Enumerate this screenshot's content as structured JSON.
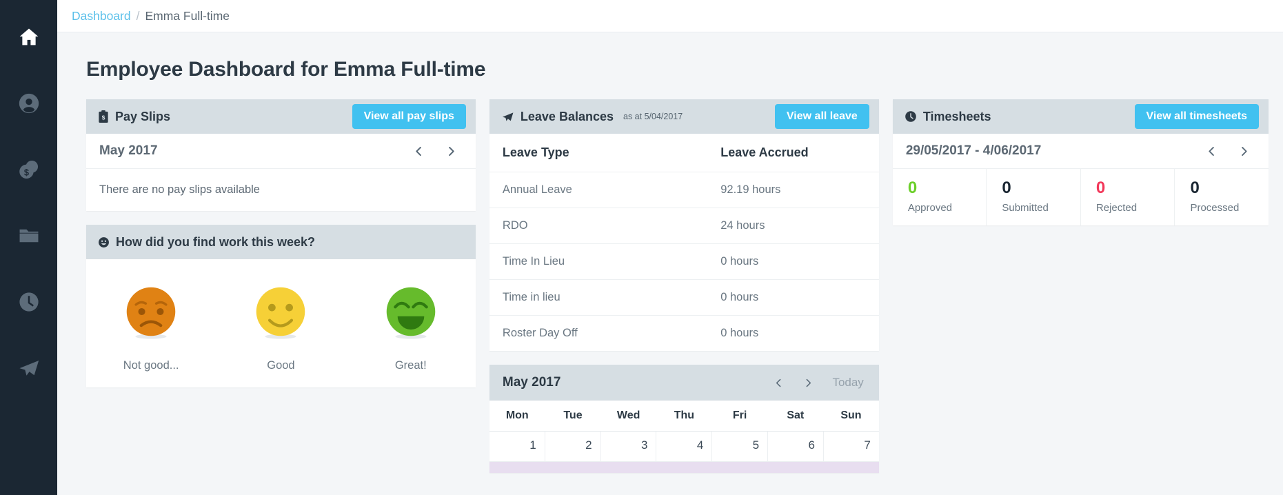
{
  "sidebar": {
    "items": [
      {
        "name": "home-icon",
        "label": "Home",
        "active": true
      },
      {
        "name": "user-icon",
        "label": "People"
      },
      {
        "name": "money-icon",
        "label": "Pay"
      },
      {
        "name": "folder-icon",
        "label": "Documents"
      },
      {
        "name": "clock-icon",
        "label": "Time"
      },
      {
        "name": "plane-icon",
        "label": "Leave"
      }
    ]
  },
  "breadcrumb": {
    "root": "Dashboard",
    "separator": "/",
    "current": "Emma Full-time"
  },
  "page": {
    "title": "Employee Dashboard for Emma Full-time"
  },
  "payslips": {
    "icon": "payslip-icon",
    "title": "Pay Slips",
    "view_all_label": "View all pay slips",
    "period": "May 2017",
    "empty_message": "There are no pay slips available"
  },
  "feedback": {
    "icon": "smiley-icon",
    "title": "How did you find work this week?",
    "options": [
      {
        "label": "Not good...",
        "mood": "sad",
        "color": "#e08214"
      },
      {
        "label": "Good",
        "mood": "neutral-happy",
        "color": "#f6d037"
      },
      {
        "label": "Great!",
        "mood": "very-happy",
        "color": "#66bb2c"
      }
    ]
  },
  "leave": {
    "icon": "plane-icon",
    "title": "Leave Balances",
    "subtitle": "as at 5/04/2017",
    "view_all_label": "View all leave",
    "columns": [
      "Leave Type",
      "Leave Accrued"
    ],
    "rows": [
      {
        "type": "Annual Leave",
        "accrued": "92.19 hours"
      },
      {
        "type": "RDO",
        "accrued": "24 hours"
      },
      {
        "type": "Time In Lieu",
        "accrued": "0 hours"
      },
      {
        "type": "Time in lieu",
        "accrued": "0 hours"
      },
      {
        "type": "Roster Day Off",
        "accrued": "0 hours"
      }
    ]
  },
  "timesheets": {
    "icon": "clock-icon",
    "title": "Timesheets",
    "view_all_label": "View all timesheets",
    "date_range": "29/05/2017 - 4/06/2017",
    "stats": [
      {
        "value": "0",
        "label": "Approved",
        "color": "#6ccf2a"
      },
      {
        "value": "0",
        "label": "Submitted",
        "color": "#1b2733"
      },
      {
        "value": "0",
        "label": "Rejected",
        "color": "#f2385a"
      },
      {
        "value": "0",
        "label": "Processed",
        "color": "#1b2733"
      }
    ]
  },
  "calendar": {
    "title": "May 2017",
    "today_label": "Today",
    "weekdays": [
      "Mon",
      "Tue",
      "Wed",
      "Thu",
      "Fri",
      "Sat",
      "Sun"
    ],
    "days": [
      "1",
      "2",
      "3",
      "4",
      "5",
      "6",
      "7"
    ]
  },
  "colors": {
    "accent": "#41c1f0",
    "sidebar": "#1b2733",
    "card_header": "#d6dee3",
    "page_bg": "#f4f6f8",
    "link": "#5bc0ea",
    "calendar_band": "#e8def0"
  }
}
